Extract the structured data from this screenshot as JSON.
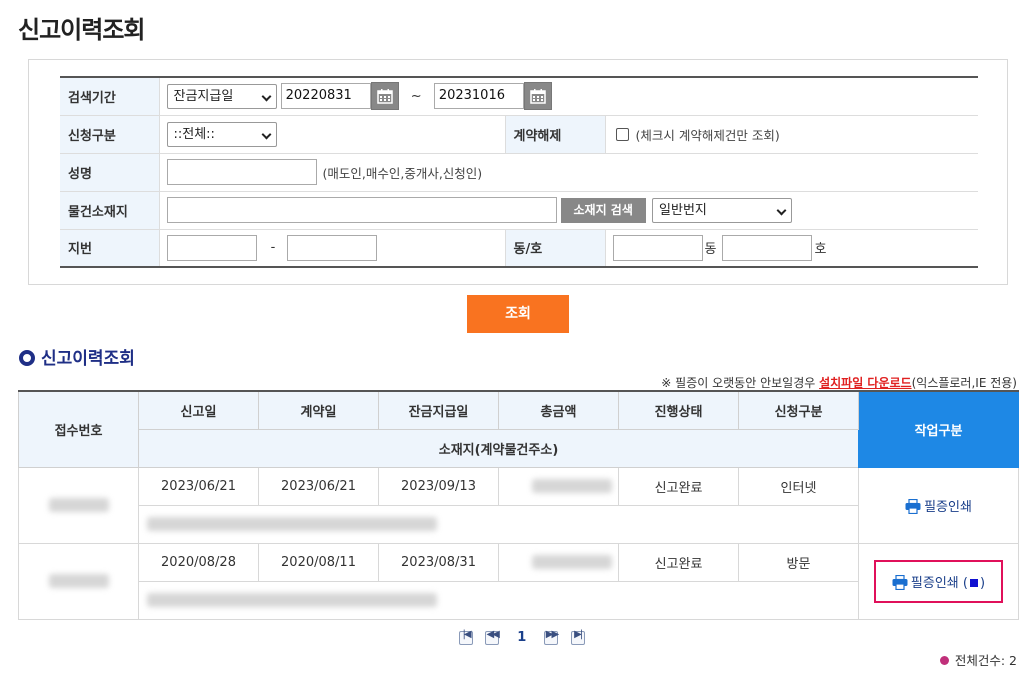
{
  "page": {
    "title": "신고이력조회"
  },
  "search": {
    "period_label": "검색기간",
    "period_type": "잔금지급일",
    "date_from": "20220831",
    "date_to": "20231016",
    "tilde": "~",
    "apply_type_label": "신청구분",
    "apply_type_value": "::전체::",
    "cancel_label": "계약해제",
    "cancel_hint": "(체크시 계약해제건만 조회)",
    "name_label": "성명",
    "name_hint": "(매도인,매수인,중개사,신청인)",
    "location_label": "물건소재지",
    "location_search_button": "소재지 검색",
    "lot_type_value": "일반번지",
    "lot_label": "지번",
    "lot_dash": "-",
    "unit_label": "동/호",
    "dong_suffix": "동",
    "ho_suffix": "호",
    "submit_button": "조회"
  },
  "results": {
    "section_title": "신고이력조회",
    "notice_prefix": "※ 필증이 오랫동안 안보일경우 ",
    "notice_link": "설치파일 다운로드",
    "notice_suffix": "(익스플로러,IE 전용)",
    "headers": {
      "receipt_no": "접수번호",
      "report_date": "신고일",
      "contract_date": "계약일",
      "balance_date": "잔금지급일",
      "total_amount": "총금액",
      "status": "진행상태",
      "apply_type": "신청구분",
      "location": "소재지(계약물건주소)",
      "work": "작업구분"
    },
    "rows": [
      {
        "report_date": "2023/06/21",
        "contract_date": "2023/06/21",
        "balance_date": "2023/09/13",
        "status": "신고완료",
        "apply_type": "인터넷",
        "action": "필증인쇄"
      },
      {
        "report_date": "2020/08/28",
        "contract_date": "2020/08/11",
        "balance_date": "2023/08/31",
        "status": "신고완료",
        "apply_type": "방문",
        "action": "필증인쇄",
        "action_open": "(",
        "action_close": ")"
      }
    ]
  },
  "pagination": {
    "current_page": "1"
  },
  "total": {
    "text": "전체건수: 2"
  },
  "colors": {
    "accent_orange": "#f97320",
    "header_blue": "#1e88e5",
    "title_navy": "#1f2f86",
    "highlight": "#e0105a"
  }
}
